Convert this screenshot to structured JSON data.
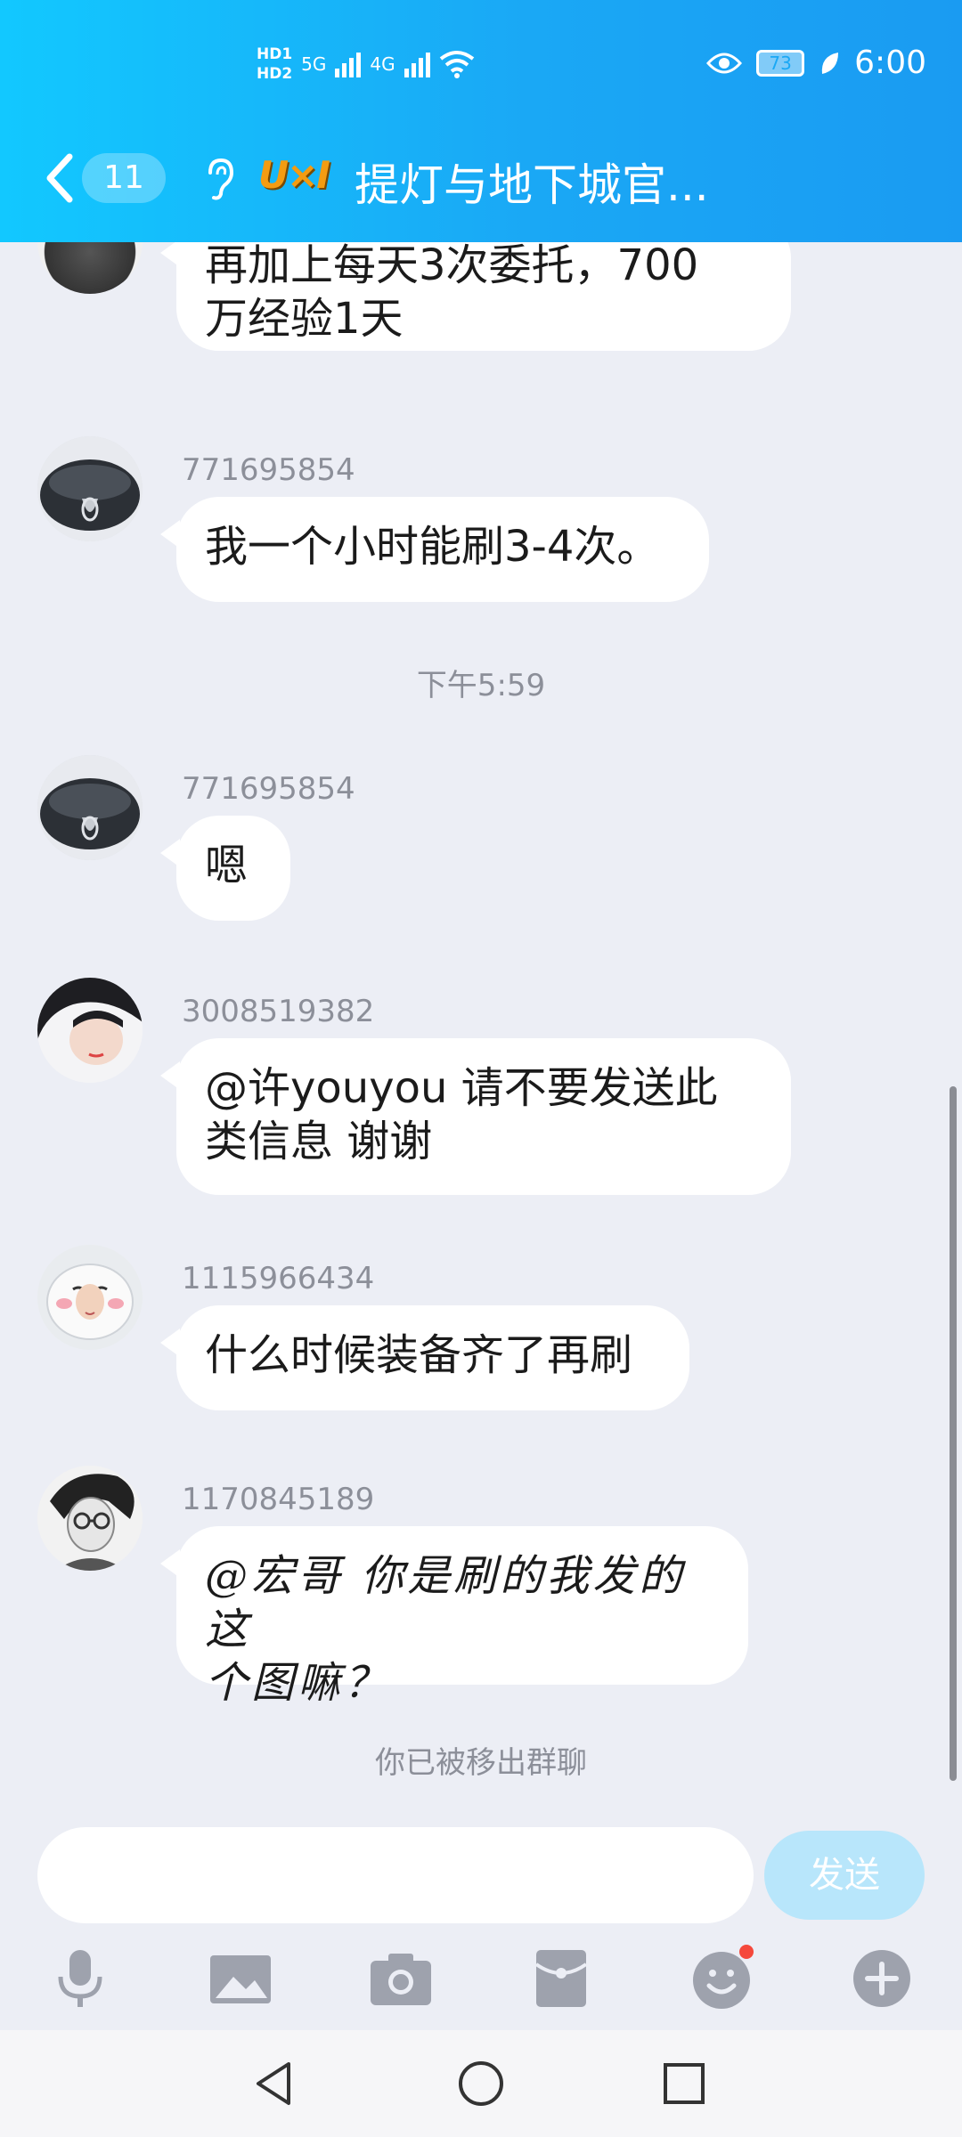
{
  "status_bar": {
    "hd1": "HD1",
    "hd2": "HD2",
    "net1": "5G",
    "net2": "4G",
    "battery": "73",
    "time": "6:00"
  },
  "header": {
    "back_icon": "chevron-left-icon",
    "unread_count": "11",
    "ear_icon": "ear-icon",
    "badge_text": "U×I",
    "title": "提灯与地下城官..."
  },
  "messages": [
    {
      "sender": "",
      "text": "再加上每天3次委托，700\n万经验1天"
    },
    {
      "sender": "771695854",
      "text": "我一个小时能刷3-4次。"
    },
    {
      "sender": "771695854",
      "text": "嗯"
    },
    {
      "sender": "3008519382",
      "text": "@许youyou 请不要发送此\n类信息 谢谢"
    },
    {
      "sender": "1115966434",
      "text": "什么时候装备齐了再刷"
    },
    {
      "sender": "1170845189",
      "text": "@宏哥 你是刷的我发的这\n个图嘛？"
    }
  ],
  "timestamp": "下午5:59",
  "system_note": "你已被移出群聊",
  "input": {
    "placeholder": "",
    "send_label": "发送"
  },
  "toolbar": [
    "microphone-icon",
    "image-icon",
    "camera-icon",
    "red-packet-icon",
    "emoji-icon",
    "plus-icon"
  ],
  "colors": {
    "header": "#1aa8f5",
    "background": "#eceef5",
    "send_disabled": "#b8e6fb"
  }
}
